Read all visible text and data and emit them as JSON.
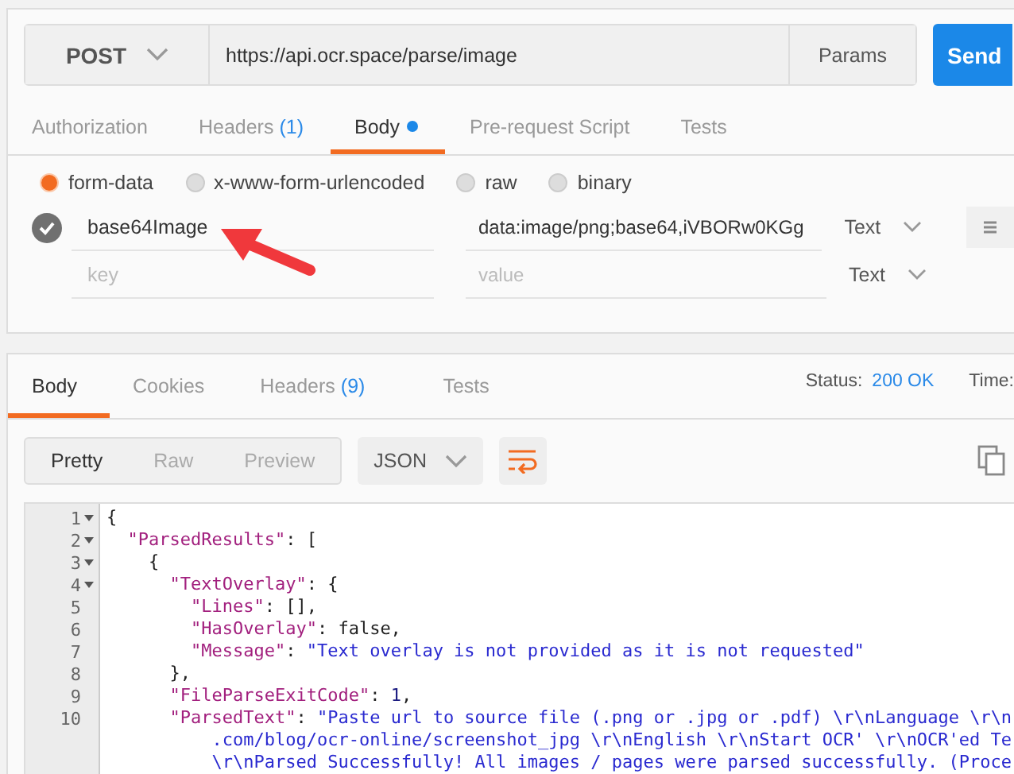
{
  "request": {
    "method": "POST",
    "url": "https://api.ocr.space/parse/image",
    "params_label": "Params",
    "send_label": "Send"
  },
  "request_tabs": [
    {
      "label": "Authorization",
      "dot": false,
      "selected": false
    },
    {
      "label": "Headers",
      "count": "(1)",
      "dot": false,
      "selected": false
    },
    {
      "label": "Body",
      "dot": true,
      "selected": true
    },
    {
      "label": "Pre-request Script",
      "dot": false,
      "selected": false
    },
    {
      "label": "Tests",
      "dot": false,
      "selected": false
    }
  ],
  "body_types": [
    {
      "label": "form-data",
      "selected": true
    },
    {
      "label": "x-www-form-urlencoded",
      "selected": false
    },
    {
      "label": "raw",
      "selected": false
    },
    {
      "label": "binary",
      "selected": false
    }
  ],
  "form_rows": [
    {
      "checked": true,
      "key": "base64Image",
      "value": "data:image/png;base64,iVBORw0KGg",
      "type": "Text"
    },
    {
      "key_placeholder": "key",
      "value_placeholder": "value",
      "type": "Text"
    }
  ],
  "response_tabs": [
    {
      "label": "Body",
      "selected": true
    },
    {
      "label": "Cookies",
      "selected": false
    },
    {
      "label": "Headers",
      "count": "(9)",
      "selected": false
    },
    {
      "label": "Tests",
      "selected": false
    }
  ],
  "status": {
    "label": "Status:",
    "value": "200 OK",
    "time_label": "Time:"
  },
  "view_modes": [
    {
      "label": "Pretty",
      "selected": true
    },
    {
      "label": "Raw",
      "selected": false
    },
    {
      "label": "Preview",
      "selected": false
    }
  ],
  "format": "JSON",
  "code_lines": [
    {
      "number": "1",
      "foldable": true,
      "tokens": [
        {
          "kind": "punct",
          "s": "{"
        }
      ]
    },
    {
      "number": "2",
      "foldable": true,
      "tokens": [
        {
          "kind": "key",
          "s": "  \"ParsedResults\""
        },
        {
          "kind": "punct",
          "s": ": ["
        }
      ]
    },
    {
      "number": "3",
      "foldable": true,
      "tokens": [
        {
          "kind": "punct",
          "s": "    {"
        }
      ]
    },
    {
      "number": "4",
      "foldable": true,
      "tokens": [
        {
          "kind": "key",
          "s": "      \"TextOverlay\""
        },
        {
          "kind": "punct",
          "s": ": {"
        }
      ]
    },
    {
      "number": "5",
      "foldable": false,
      "tokens": [
        {
          "kind": "key",
          "s": "        \"Lines\""
        },
        {
          "kind": "punct",
          "s": ": [],"
        }
      ]
    },
    {
      "number": "6",
      "foldable": false,
      "tokens": [
        {
          "kind": "key",
          "s": "        \"HasOverlay\""
        },
        {
          "kind": "punct",
          "s": ": false,"
        }
      ]
    },
    {
      "number": "7",
      "foldable": false,
      "tokens": [
        {
          "kind": "key",
          "s": "        \"Message\""
        },
        {
          "kind": "punct",
          "s": ": "
        },
        {
          "kind": "string",
          "s": "\"Text overlay is not provided as it is not requested\""
        }
      ]
    },
    {
      "number": "8",
      "foldable": false,
      "tokens": [
        {
          "kind": "punct",
          "s": "      },"
        }
      ]
    },
    {
      "number": "9",
      "foldable": false,
      "tokens": [
        {
          "kind": "key",
          "s": "      \"FileParseExitCode\""
        },
        {
          "kind": "punct",
          "s": ": "
        },
        {
          "kind": "number",
          "s": "1"
        },
        {
          "kind": "punct",
          "s": ","
        }
      ]
    },
    {
      "number": "10",
      "foldable": false,
      "tokens": [
        {
          "kind": "key",
          "s": "      \"ParsedText\""
        },
        {
          "kind": "punct",
          "s": ": "
        },
        {
          "kind": "string",
          "s": "\"Paste url to source file (.png or .jpg or .pdf) \\r\\nLanguage \\r\\n"
        }
      ]
    },
    {
      "tokens": [
        {
          "kind": "string",
          "s": "          .com/blog/ocr-online/screenshot_jpg \\r\\nEnglish \\r\\nStart OCR' \\r\\nOCR'ed Te"
        }
      ]
    },
    {
      "tokens": [
        {
          "kind": "string",
          "s": "          \\r\\nParsed Successfully! All images / pages were parsed successfully. (Proce"
        }
      ]
    }
  ]
}
